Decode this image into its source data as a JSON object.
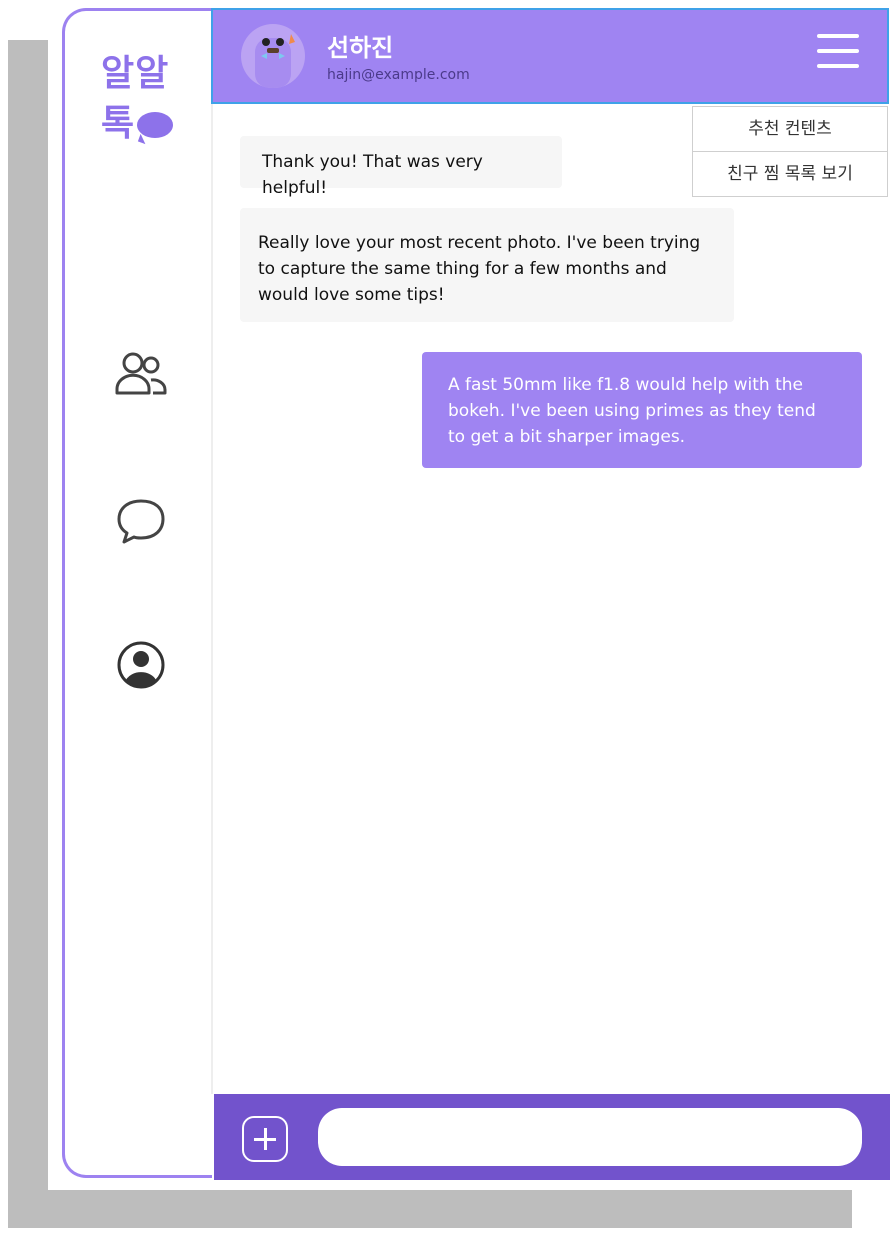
{
  "app": {
    "logo_line1": "알알",
    "logo_line2": "톡"
  },
  "sidebar": {
    "icons": [
      "friends-icon",
      "chat-bubble-icon",
      "profile-icon"
    ]
  },
  "header": {
    "name": "선하진",
    "email": "hajin@example.com"
  },
  "menu": {
    "items": [
      "추천 컨텐츠",
      "친구 찜 목록 보기"
    ]
  },
  "messages": [
    {
      "direction": "in",
      "text": "Thank you! That was very helpful!"
    },
    {
      "direction": "in",
      "text": "Really love your most recent photo. I've been trying to capture the same thing for a few months and would love some tips!"
    },
    {
      "direction": "out",
      "text": "A fast 50mm like f1.8 would help with the bokeh. I've been using primes as they tend to get a bit sharper images."
    }
  ],
  "composer": {
    "value": "",
    "placeholder": ""
  },
  "colors": {
    "accent": "#9f84f2",
    "accent_dark": "#7253cc",
    "header_border": "#3fa2e8"
  }
}
